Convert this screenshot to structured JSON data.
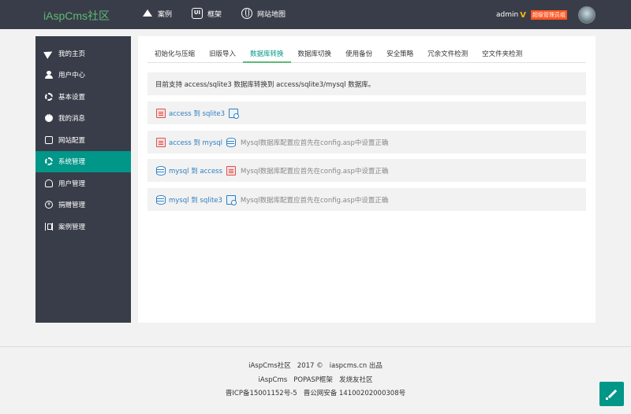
{
  "header": {
    "logo": "iAspCms社区",
    "nav": [
      {
        "label": "案例",
        "icon": "crown-icon"
      },
      {
        "label": "框架",
        "icon": "ui-icon"
      },
      {
        "label": "网站地图",
        "icon": "globe-icon"
      }
    ],
    "user": {
      "name": "admin",
      "vip_mark": "V",
      "role": "超级管理员组"
    }
  },
  "sidebar": {
    "items": [
      {
        "label": "我的主页",
        "icon": "plane-icon"
      },
      {
        "label": "用户中心",
        "icon": "person-icon"
      },
      {
        "label": "基本设置",
        "icon": "gear-icon"
      },
      {
        "label": "我的消息",
        "icon": "chat-icon"
      },
      {
        "label": "网站配置",
        "icon": "camera-icon"
      },
      {
        "label": "系统管理",
        "icon": "gear-icon",
        "active": true
      },
      {
        "label": "用户管理",
        "icon": "user-icon"
      },
      {
        "label": "捐赠管理",
        "icon": "yen-icon"
      },
      {
        "label": "案例管理",
        "icon": "case-icon"
      }
    ]
  },
  "tabs": [
    "初始化与压缩",
    "旧版导入",
    "数据库转换",
    "数据库切换",
    "使用备份",
    "安全策略",
    "冗余文件检测",
    "空文件夹检测"
  ],
  "active_tab": "数据库转换",
  "notice": "目前支持 access/sqlite3 数据库转换到 access/sqlite3/mysql 数据库。",
  "conversions": [
    {
      "label": "access 到 sqlite3",
      "note": ""
    },
    {
      "label": "access 到 mysql",
      "note": "Mysql数据库配置应首先在config.asp中设置正确"
    },
    {
      "label": "mysql 到 access",
      "note": "Mysql数据库配置应首先在config.asp中设置正确"
    },
    {
      "label": "mysql 到 sqlite3",
      "note": "Mysql数据库配置应首先在config.asp中设置正确"
    }
  ],
  "footer": {
    "line1": [
      "iAspCms社区",
      "2017 ©",
      "iaspcms.cn 出品"
    ],
    "line2": [
      "iAspCms",
      "POPASP框架",
      "发烧友社区"
    ],
    "line3": [
      "晋ICP备15001152号-5",
      "晋公网安备 14100202000308号"
    ]
  },
  "colors": {
    "header_bg": "#393d49",
    "accent": "#009688",
    "logo": "#5fb878",
    "link": "#2f7ec0",
    "badge": "#ff5722"
  }
}
